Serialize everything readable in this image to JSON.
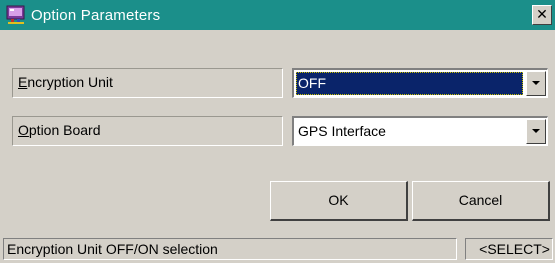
{
  "window": {
    "title": "Option Parameters",
    "title_bar_color": "#1b8f8a",
    "close_icon": "close-icon",
    "app_icon": "app-icon"
  },
  "fields": [
    {
      "label_mnemonic": "E",
      "label_rest": "ncryption Unit",
      "value": "OFF",
      "selected": true
    },
    {
      "label_mnemonic": "O",
      "label_rest": "ption Board",
      "value": "GPS Interface",
      "selected": false
    }
  ],
  "buttons": {
    "ok_label": "OK",
    "cancel_label": "Cancel"
  },
  "status": {
    "message": "Encryption Unit OFF/ON selection",
    "mode": "<SELECT>"
  },
  "colors": {
    "selection": "#0a246a",
    "face": "#d4d0c8"
  }
}
